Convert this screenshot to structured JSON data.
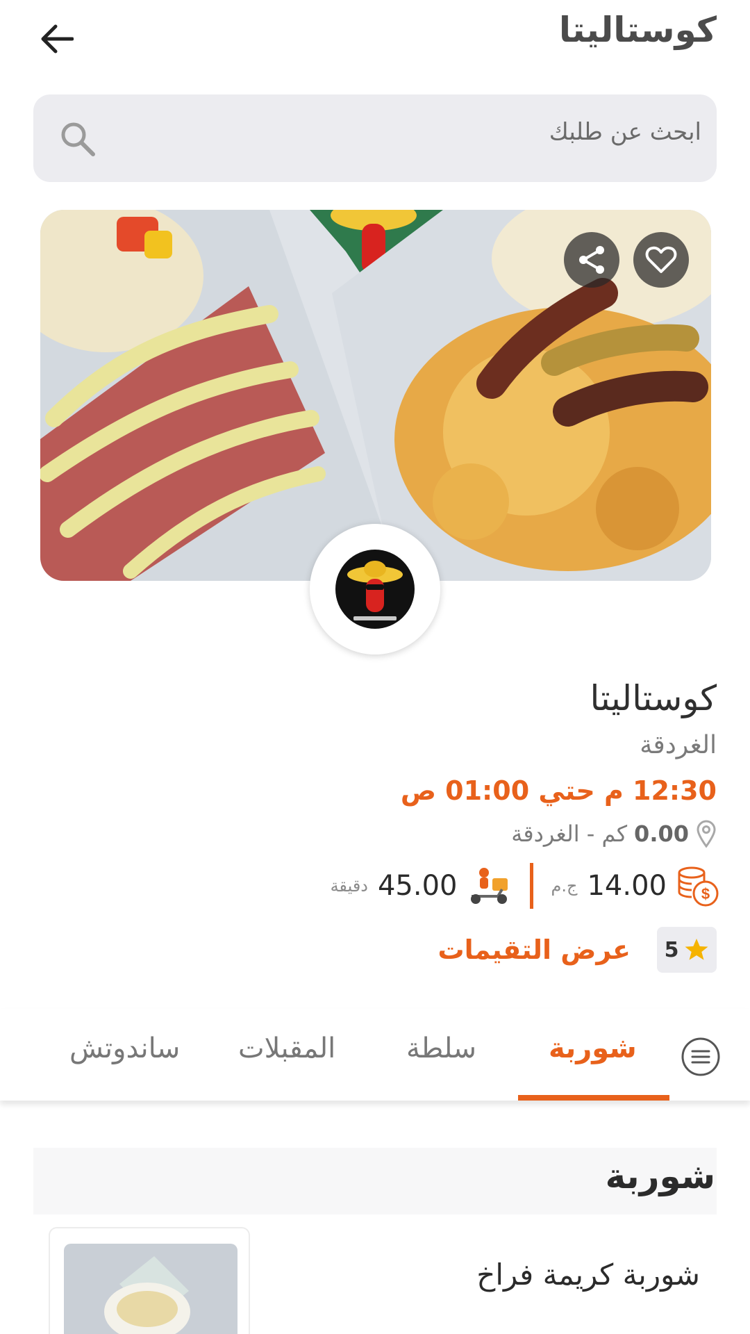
{
  "header": {
    "title": "كوستاليتا",
    "back_icon": "arrow-left-icon"
  },
  "search": {
    "placeholder": "ابحث عن طلبك",
    "icon": "search-icon"
  },
  "hero": {
    "share_icon": "share-icon",
    "favorite_icon": "heart-icon"
  },
  "restaurant": {
    "name": "كوستاليتا",
    "city": "الغردقة",
    "hours": "12:30 م حتي 01:00 ص",
    "distance_value": "0.00",
    "distance_text": "كم - الغردقة",
    "delivery_fee": "14.00",
    "currency": "ج.م",
    "delivery_time": "45.00",
    "time_unit": "دقيقة",
    "rating": "5",
    "reviews_link": "عرض التقيمات"
  },
  "tabs": [
    {
      "label": "شوربة",
      "active": true
    },
    {
      "label": "سلطة",
      "active": false
    },
    {
      "label": "المقبلات",
      "active": false
    },
    {
      "label": "ساندوتش",
      "active": false
    }
  ],
  "section": {
    "title": "شوربة"
  },
  "items": [
    {
      "name": "شوربة كريمة فراخ"
    }
  ],
  "colors": {
    "accent": "#e8611b",
    "search_bg": "#ececf0",
    "star": "#f5b301"
  }
}
